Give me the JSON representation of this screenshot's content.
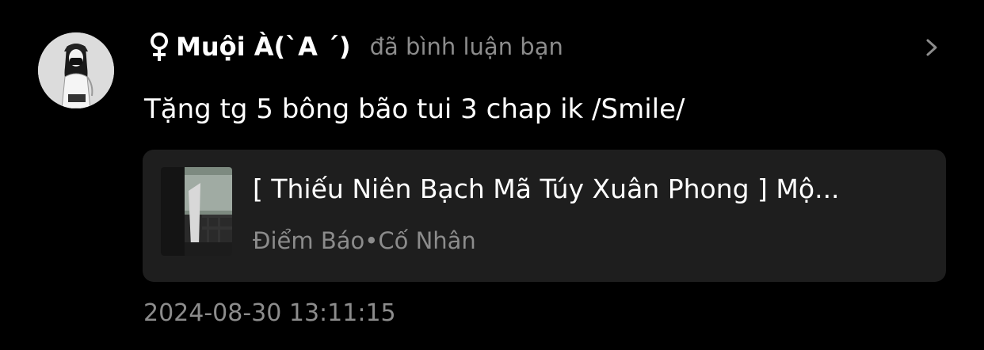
{
  "user": {
    "gender_symbol": "♀",
    "name": "Muội À(ˋA ˊ)",
    "avatar_icon": "user-avatar-photo"
  },
  "action_text": "đã bình luận bạn",
  "comment": "Tặng tg 5 bông bão tui 3 chap ik /Smile/",
  "post": {
    "title": "[ Thiếu Niên Bạch Mã Túy Xuân Phong ] Mộ...",
    "meta": "Điểm Báo•Cố Nhân"
  },
  "timestamp": "2024-08-30 13:11:15",
  "colors": {
    "background": "#000000",
    "card": "#1e1e1e",
    "secondary_text": "#8c8c8c",
    "primary_text": "#ffffff"
  }
}
